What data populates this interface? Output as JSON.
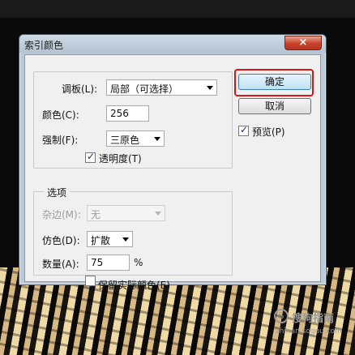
{
  "window": {
    "title": "索引颜色",
    "close_glyph": "×"
  },
  "palette_group": {
    "palette_label": "调板(L):",
    "palette_value": "局部（可选择）",
    "colors_label": "颜色(C):",
    "colors_value": "256",
    "forced_label": "强制(F):",
    "forced_value": "三原色",
    "transparency_label": "透明度(T)",
    "transparency_checked": true
  },
  "options_group": {
    "legend": "选项",
    "matte_label": "杂边(M):",
    "matte_value": "无",
    "dither_label": "仿色(D):",
    "dither_value": "扩散",
    "amount_label": "数量(A):",
    "amount_value": "75",
    "amount_unit": "%",
    "preserve_label": "保留实际颜色(E)",
    "preserve_checked": false
  },
  "buttons": {
    "ok": "确定",
    "cancel": "取消"
  },
  "preview": {
    "label": "预览(P)",
    "checked": true
  },
  "watermark": {
    "logo": "S",
    "title": "搜狗指南",
    "url": "zhinan.sogou.com"
  },
  "colors": {
    "highlight": "#d01818",
    "ok_border": "#3c7fb1"
  }
}
